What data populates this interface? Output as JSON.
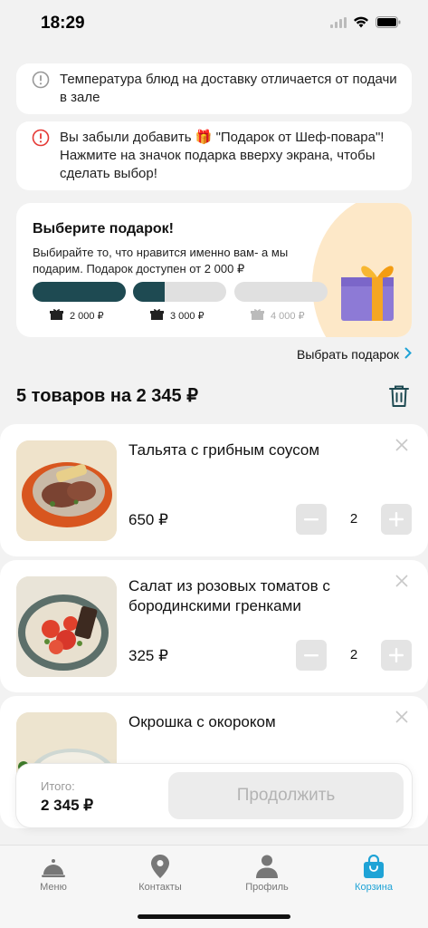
{
  "status_bar": {
    "time": "18:29"
  },
  "notices": [
    {
      "text": "Температура блюд на доставку отличается от подачи в зале",
      "icon": "info-icon",
      "color": "#999999"
    },
    {
      "text": "Вы забыли добавить 🎁 \"Подарок от Шеф-повара\"! Нажмите на значок подарка вверху экрана, чтобы сделать выбор!",
      "icon": "alert-icon",
      "color": "#e53935"
    }
  ],
  "gift": {
    "title": "Выберите подарок!",
    "description": "Выбирайте то, что нравится именно вам- а мы подарим. Подарок доступен от 2 000 ₽",
    "tiers": [
      {
        "amount": "2 000 ₽",
        "progress": 1.0,
        "unlocked": true
      },
      {
        "amount": "3 000 ₽",
        "progress": 0.34,
        "unlocked": true
      },
      {
        "amount": "4 000 ₽",
        "progress": 0.0,
        "unlocked": false
      }
    ],
    "choose_link": "Выбрать подарок"
  },
  "cart": {
    "summary": "5 товаров на 2 345 ₽",
    "items": [
      {
        "name": "Тальята с грибным соусом",
        "price": "650 ₽",
        "qty": "2"
      },
      {
        "name": "Салат из розовых томатов с бородинскими гренками",
        "price": "325 ₽",
        "qty": "2"
      },
      {
        "name": "Окрошка с окороком",
        "price": "",
        "qty": ""
      }
    ]
  },
  "total": {
    "label": "Итого:",
    "value": "2 345 ₽",
    "continue_label": "Продолжить"
  },
  "tabs": [
    {
      "label": "Меню",
      "icon": "cloche-icon",
      "active": false
    },
    {
      "label": "Контакты",
      "icon": "location-pin-icon",
      "active": false
    },
    {
      "label": "Профиль",
      "icon": "user-icon",
      "active": false
    },
    {
      "label": "Корзина",
      "icon": "shopping-bag-icon",
      "active": true
    }
  ],
  "colors": {
    "accent": "#1fa3d6",
    "progress": "#1e4a52",
    "alert": "#e53935"
  }
}
